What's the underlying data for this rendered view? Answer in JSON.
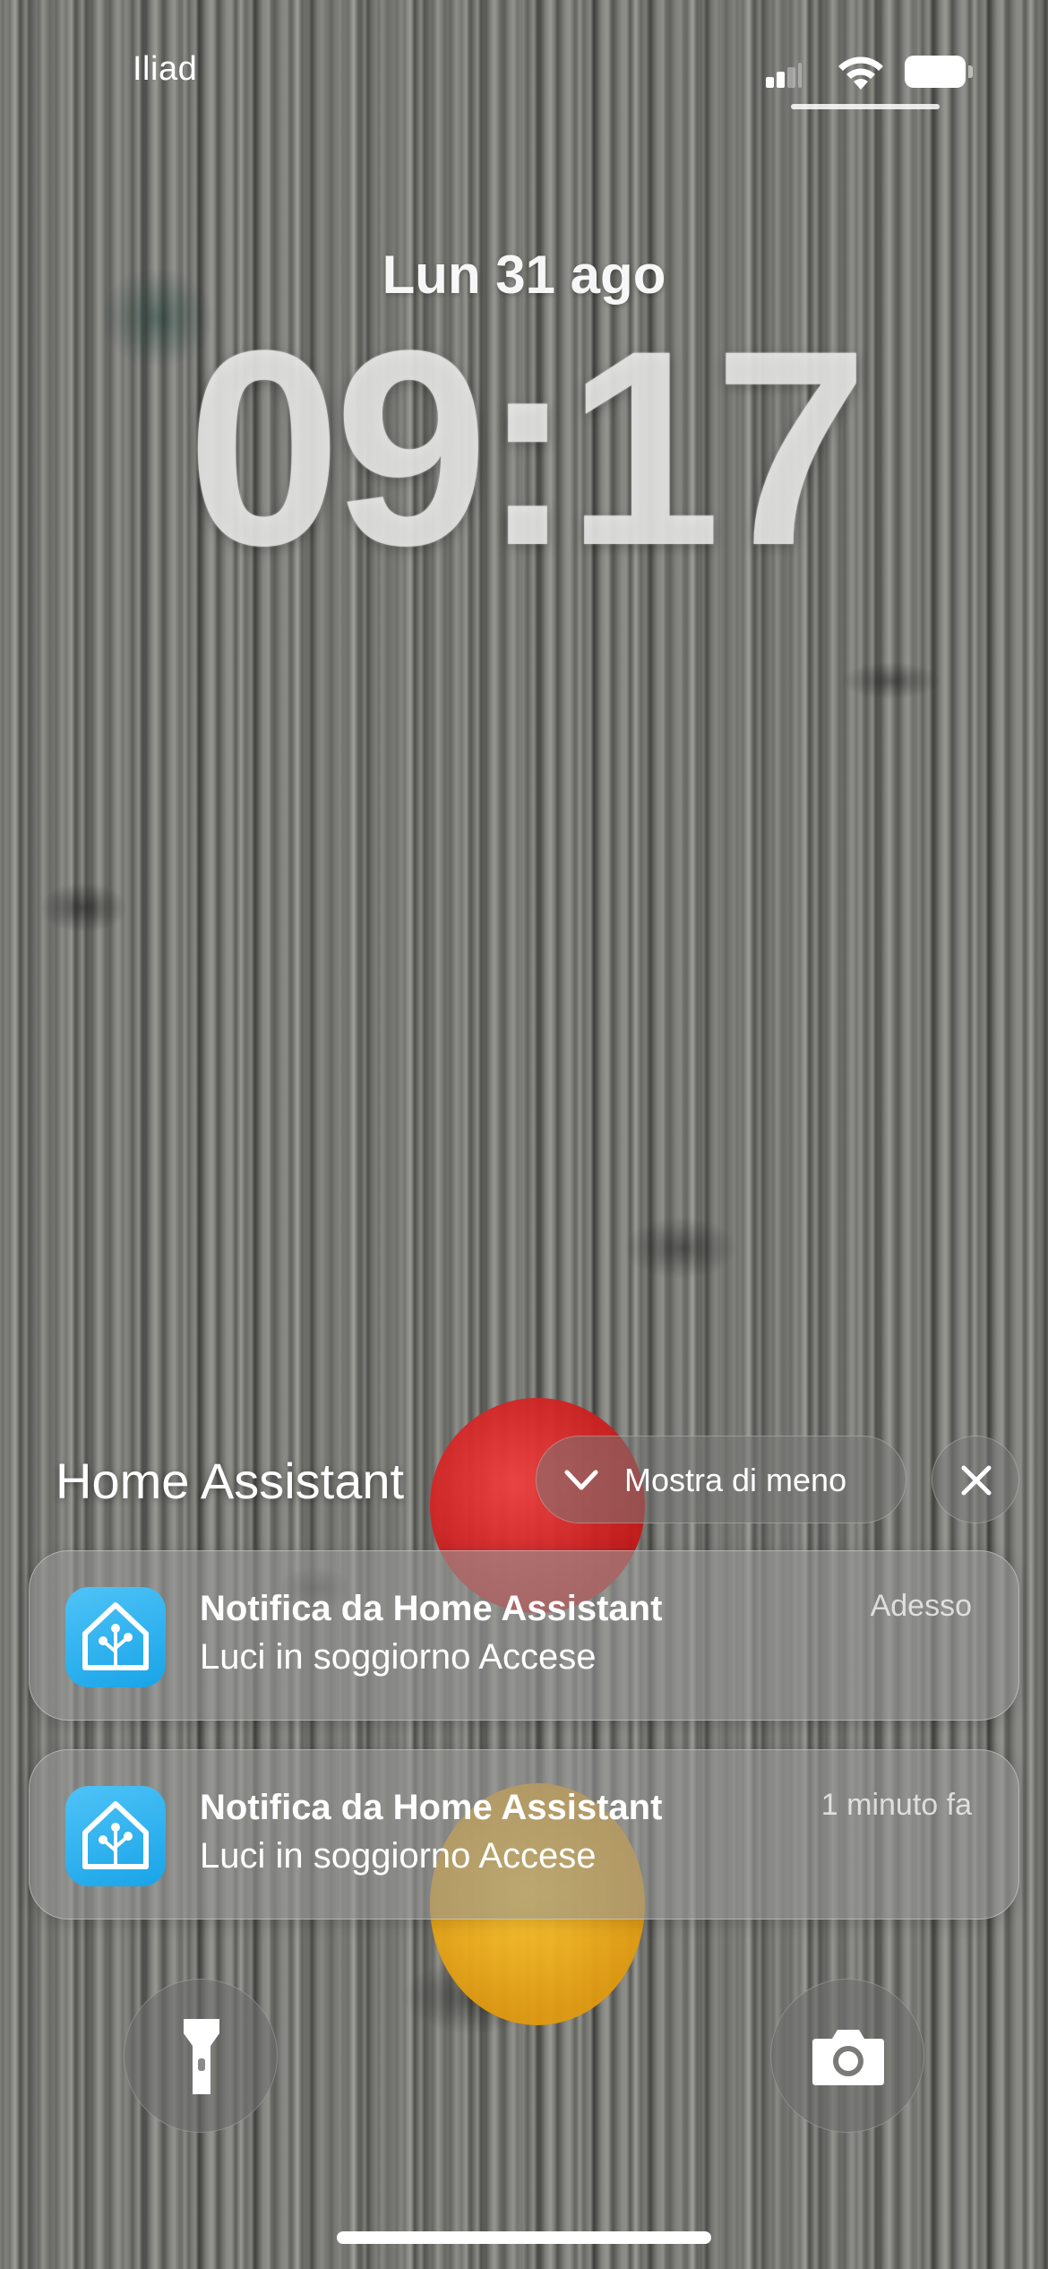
{
  "status_bar": {
    "carrier": "Iliad",
    "signal_bars_active": 2,
    "signal_bars_total": 4,
    "wifi": "wifi-icon",
    "battery": "battery-icon"
  },
  "lock_screen": {
    "date": "Lun 31 ago",
    "time": "09:17"
  },
  "notification_group": {
    "app_name": "Home Assistant",
    "show_less_label": "Mostra di meno",
    "show_less_icon": "chevron-down-icon",
    "close_icon": "close-icon",
    "notifications": [
      {
        "icon": "home-assistant-icon",
        "title": "Notifica da Home Assistant",
        "body": "Luci in soggiorno Accese",
        "time": "Adesso"
      },
      {
        "icon": "home-assistant-icon",
        "title": "Notifica da Home Assistant",
        "body": "Luci in soggiorno Accese",
        "time": "1 minuto fa"
      }
    ]
  },
  "quick_actions": {
    "left": "flashlight-icon",
    "right": "camera-icon"
  },
  "colors": {
    "app_icon_accent": "#18a4e8",
    "text": "#ffffff"
  }
}
